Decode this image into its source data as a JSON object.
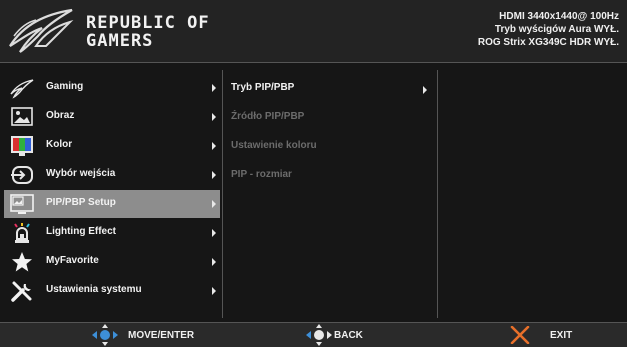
{
  "header": {
    "brand_line1": "REPUBLIC OF",
    "brand_line2": "GAMERS",
    "status_line1": "HDMI  3440x1440@  100Hz",
    "status_line2": "Tryb wyścigów  Aura WYŁ.",
    "status_line3": "ROG Strix XG349C  HDR WYŁ."
  },
  "menu": {
    "items": [
      {
        "label": "Gaming",
        "icon": "gaming-icon"
      },
      {
        "label": "Obraz",
        "icon": "image-icon"
      },
      {
        "label": "Kolor",
        "icon": "color-icon"
      },
      {
        "label": "Wybór wejścia",
        "icon": "input-select-icon"
      },
      {
        "label": "PIP/PBP Setup",
        "icon": "pip-pbp-icon",
        "selected": true
      },
      {
        "label": "Lighting Effect",
        "icon": "lighting-icon"
      },
      {
        "label": "MyFavorite",
        "icon": "star-icon"
      },
      {
        "label": "Ustawienia systemu",
        "icon": "tools-icon"
      }
    ]
  },
  "submenu": {
    "items": [
      {
        "label": "Tryb PIP/PBP",
        "enabled": true
      },
      {
        "label": "Źródło PIP/PBP",
        "enabled": false
      },
      {
        "label": "Ustawienie koloru",
        "enabled": false
      },
      {
        "label": "PIP - rozmiar",
        "enabled": false
      }
    ]
  },
  "footer": {
    "move_label": "MOVE/ENTER",
    "back_label": "BACK",
    "exit_label": "EXIT"
  },
  "colors": {
    "selected_bg": "#8d8d8d",
    "accent_blue": "#3d8fd8",
    "exit_orange": "#e8702a"
  }
}
